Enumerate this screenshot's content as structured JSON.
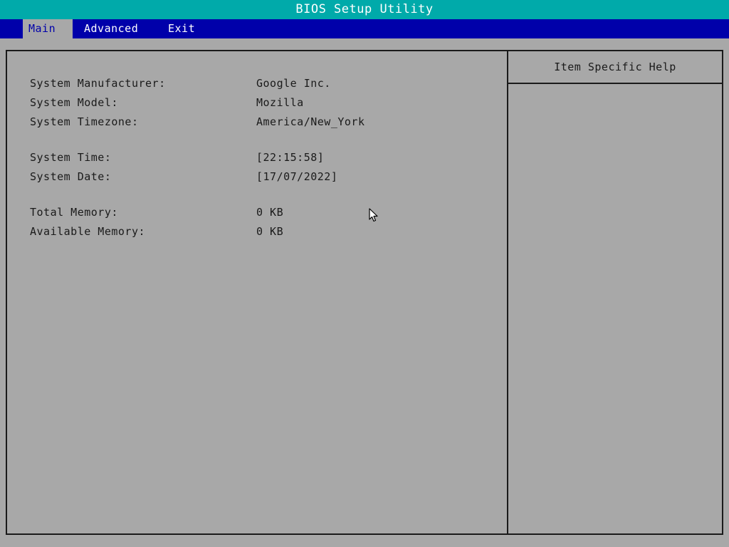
{
  "window": {
    "title": "BIOS Setup Utility"
  },
  "menu": {
    "tabs": [
      {
        "label": "Main",
        "active": true
      },
      {
        "label": "Advanced",
        "active": false
      },
      {
        "label": "Exit",
        "active": false
      }
    ]
  },
  "main": {
    "manufacturer_label": "System Manufacturer:",
    "manufacturer_value": "Google Inc.",
    "model_label": "System Model:",
    "model_value": "Mozilla",
    "timezone_label": "System Timezone:",
    "timezone_value": "America/New_York",
    "time_label": "System Time:",
    "time_value": "[22:15:58]",
    "date_label": "System Date:",
    "date_value": "[17/07/2022]",
    "total_memory_label": "Total Memory:",
    "total_memory_value": "0 KB",
    "available_memory_label": "Available Memory:",
    "available_memory_value": "0 KB"
  },
  "help": {
    "title": "Item Specific Help"
  },
  "colors": {
    "title_bar": "#00aaaa",
    "menu_bar": "#0000aa",
    "background": "#a8a8a8",
    "text": "#1a1a1a"
  },
  "icons": {
    "cursor": "mouse-pointer-icon"
  }
}
